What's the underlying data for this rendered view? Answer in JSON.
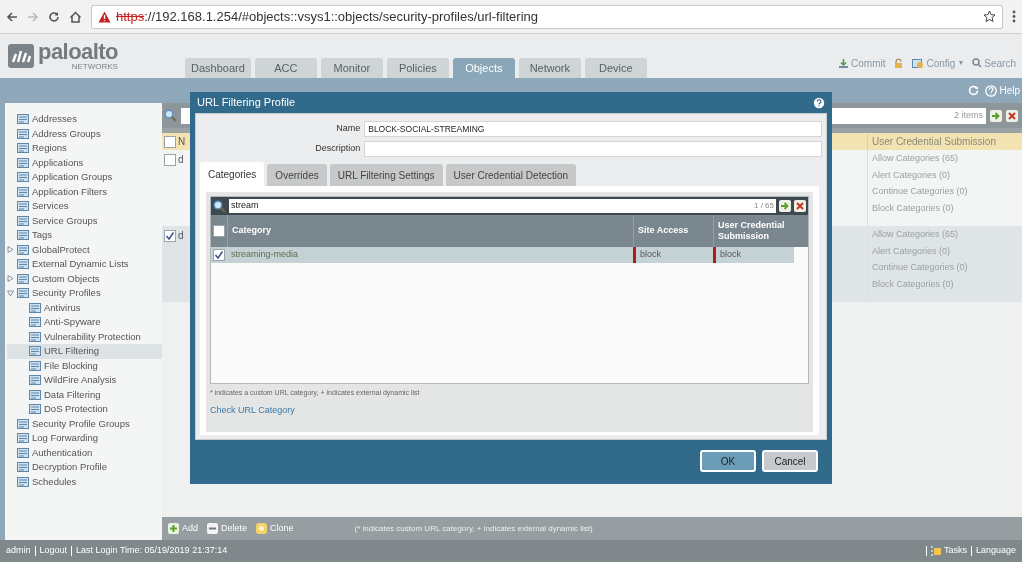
{
  "browser": {
    "scheme": "https",
    "address": "://192.168.1.254/#objects::vsys1::objects/security-profiles/url-filtering",
    "insecure": true
  },
  "logo": {
    "name": "paloalto",
    "sub": "NETWORKS"
  },
  "tabs": [
    {
      "label": "Dashboard",
      "selected": false
    },
    {
      "label": "ACC",
      "selected": false
    },
    {
      "label": "Monitor",
      "selected": false
    },
    {
      "label": "Policies",
      "selected": false
    },
    {
      "label": "Objects",
      "selected": true
    },
    {
      "label": "Network",
      "selected": false
    },
    {
      "label": "Device",
      "selected": false
    }
  ],
  "header_actions": [
    {
      "label": "Commit",
      "kind": "commit"
    },
    {
      "kind": "lock"
    },
    {
      "label": "Config",
      "kind": "config",
      "caret": "▼"
    },
    {
      "label": "Search",
      "kind": "search"
    }
  ],
  "help": "Help",
  "sidebar": {
    "items": [
      {
        "label": "Addresses",
        "selected": false
      },
      {
        "label": "Address Groups",
        "selected": false
      },
      {
        "label": "Regions",
        "selected": false
      },
      {
        "label": "Applications",
        "selected": false
      },
      {
        "label": "Application Groups",
        "selected": false
      },
      {
        "label": "Application Filters",
        "selected": false
      },
      {
        "label": "Services",
        "selected": false
      },
      {
        "label": "Service Groups",
        "selected": false
      },
      {
        "label": "Tags",
        "selected": false
      },
      {
        "label": "GlobalProtect",
        "selected": false,
        "expanded": false
      },
      {
        "label": "External Dynamic Lists",
        "selected": false
      },
      {
        "label": "Custom Objects",
        "selected": false,
        "expanded": false
      },
      {
        "label": "Security Profiles",
        "selected": false,
        "expanded": true,
        "children": [
          {
            "label": "Antivirus",
            "selected": false
          },
          {
            "label": "Anti-Spyware",
            "selected": false
          },
          {
            "label": "Vulnerability Protection",
            "selected": false
          },
          {
            "label": "URL Filtering",
            "selected": true
          },
          {
            "label": "File Blocking",
            "selected": false
          },
          {
            "label": "WildFire Analysis",
            "selected": false
          },
          {
            "label": "Data Filtering",
            "selected": false
          },
          {
            "label": "DoS Protection",
            "selected": false
          }
        ]
      },
      {
        "label": "Security Profile Groups",
        "selected": false
      },
      {
        "label": "Log Forwarding",
        "selected": false
      },
      {
        "label": "Authentication",
        "selected": false
      },
      {
        "label": "Decryption Profile",
        "selected": false
      },
      {
        "label": "Schedules",
        "selected": false
      }
    ]
  },
  "table": {
    "count": "2 items",
    "all_checked": false,
    "columns": [
      "N",
      "User Credential Submission"
    ],
    "rows": [
      {
        "checked": false,
        "selected": false,
        "name": "d",
        "lines": [
          "Allow Categories (65)",
          "Alert Categories (0)",
          "Continue Categories (0)",
          "Block Categories (0)"
        ]
      },
      {
        "checked": true,
        "selected": true,
        "name": "d",
        "lines": [
          "Allow Categories (65)",
          "Alert Categories (0)",
          "Continue Categories (0)",
          "Block Categories (0)"
        ]
      }
    ]
  },
  "toolbar": [
    {
      "label": "Add",
      "kind": "add"
    },
    {
      "label": "Delete",
      "kind": "delete"
    },
    {
      "label": "Clone",
      "kind": "clone"
    }
  ],
  "toolbar_note": "(* indicates custom URL category, + indicates external dynamic list)",
  "status_bar": {
    "left": [
      "admin",
      "Logout",
      "Last Login Time: 05/19/2019 21:37:14"
    ],
    "right": [
      {
        "label": "Tasks",
        "kind": "tasks"
      },
      {
        "label": "Language",
        "kind": "plain"
      }
    ]
  },
  "dialog": {
    "title": "URL Filtering Profile",
    "fields": [
      {
        "label": "Name",
        "value": "BLOCK-SOCIAL-STREAMING"
      },
      {
        "label": "Description"
      }
    ],
    "tabs": [
      {
        "label": "Categories",
        "selected": true
      },
      {
        "label": "Overrides",
        "selected": false
      },
      {
        "label": "URL Filtering Settings",
        "selected": false
      },
      {
        "label": "User Credential Detection",
        "selected": false
      }
    ],
    "search": {
      "value": "stream",
      "count": "1 / 65"
    },
    "all_checked": false,
    "columns": [
      "Category",
      "Site Access",
      "User Credential Submission"
    ],
    "rows": [
      {
        "checked": true,
        "selected": true,
        "cells": [
          "streaming-media",
          "block",
          "block"
        ]
      }
    ],
    "footnote": "* indicates a custom URL category, + indicates external dynamic list",
    "link": "Check URL Category",
    "buttons": [
      {
        "label": "OK",
        "kind": "primary"
      },
      {
        "label": "Cancel",
        "kind": "secondary"
      }
    ]
  }
}
